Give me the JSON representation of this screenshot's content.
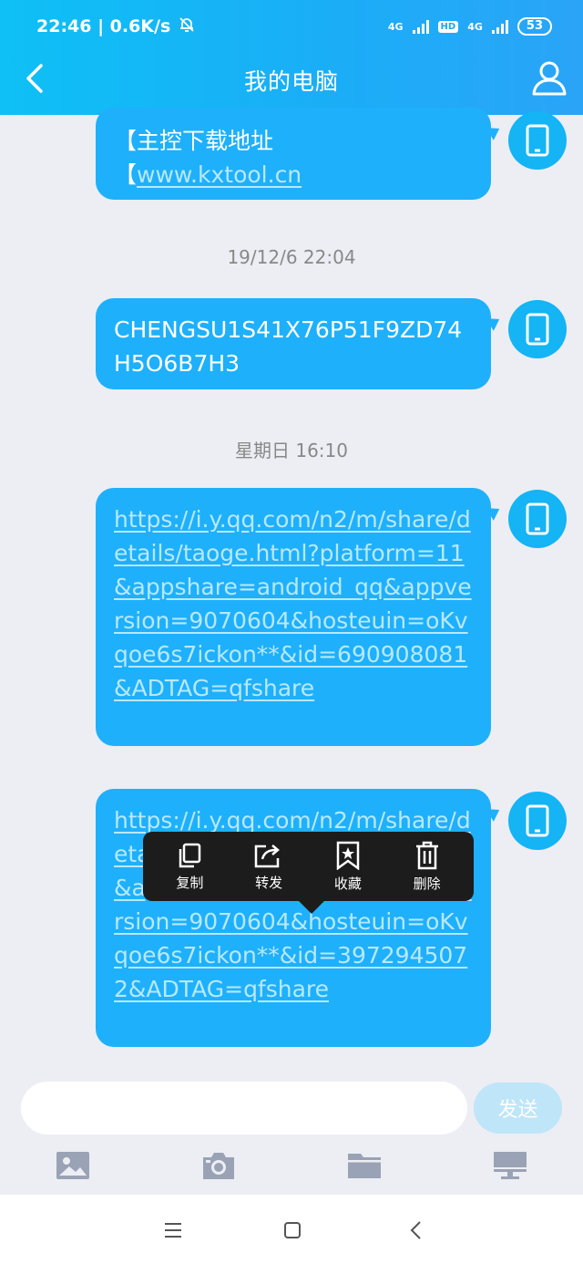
{
  "status": {
    "time": "22:46 | 0.6K/s",
    "net1": "4G",
    "hd": "HD",
    "net2": "4G",
    "battery": "53"
  },
  "header": {
    "title": "我的电脑"
  },
  "messages": [
    {
      "line1": "【主控下载地址",
      "line2_prefix": "【",
      "link": "www.kxtool.cn"
    },
    {
      "timestamp": "19/12/6 22:04",
      "text": "CHENGSU1S41X76P51F9ZD74H5O6B7H3"
    },
    {
      "timestamp": "星期日 16:10",
      "link": "https://i.y.qq.com/n2/m/share/details/taoge.html?platform=11&appshare=android_qq&appversion=9070604&hosteuin=oKvqoe6s7ickon**&id=690908081&ADTAG=qfshare"
    },
    {
      "link": "https://i.y.qq.com/n2/m/share/details/taoge.html?platform=11&appshare=android_qq&appversion=9070604&hosteuin=oKvqoe6s7ickon**&id=3972945072&ADTAG=qfshare"
    }
  ],
  "context_menu": {
    "copy": "复制",
    "forward": "转发",
    "favorite": "收藏",
    "delete": "删除"
  },
  "input": {
    "placeholder": "",
    "send_label": "发送"
  },
  "toolbar": {
    "icons": [
      "image-icon",
      "camera-icon",
      "folder-icon",
      "computer-icon"
    ]
  },
  "colors": {
    "accent": "#1eb0fb",
    "header": "#14b0f6"
  }
}
